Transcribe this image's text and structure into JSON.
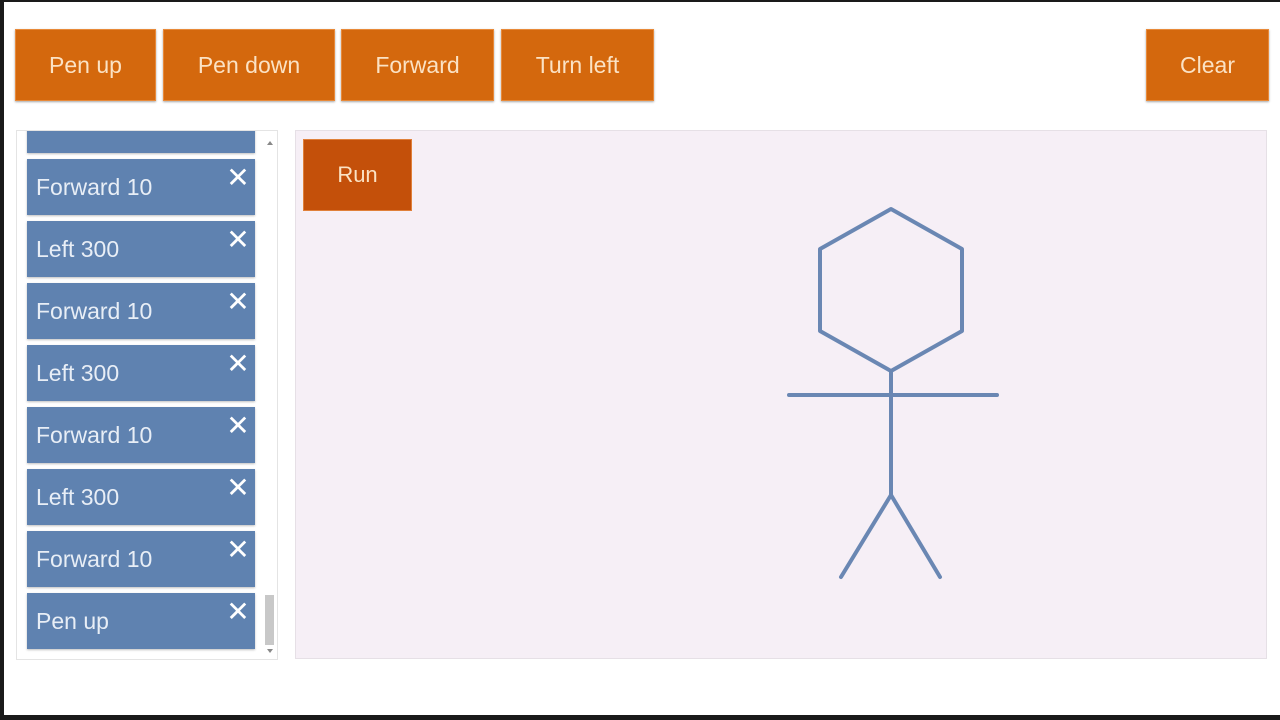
{
  "toolbar": {
    "pen_up": "Pen up",
    "pen_down": "Pen down",
    "forward": "Forward",
    "turn_left": "Turn left",
    "clear": "Clear"
  },
  "command_list": {
    "items": [
      {
        "label": "Forward 10"
      },
      {
        "label": "Left 300"
      },
      {
        "label": "Forward 10"
      },
      {
        "label": "Left 300"
      },
      {
        "label": "Forward 10"
      },
      {
        "label": "Left 300"
      },
      {
        "label": "Forward 10"
      },
      {
        "label": "Pen up"
      }
    ],
    "remove_glyph": "✕"
  },
  "canvas": {
    "run_label": "Run",
    "stroke_color": "#6a87b3",
    "background": "#f6eff6"
  },
  "colors": {
    "button": "#d4680d",
    "run_button": "#c4500a",
    "list_item": "#5f82b0"
  }
}
